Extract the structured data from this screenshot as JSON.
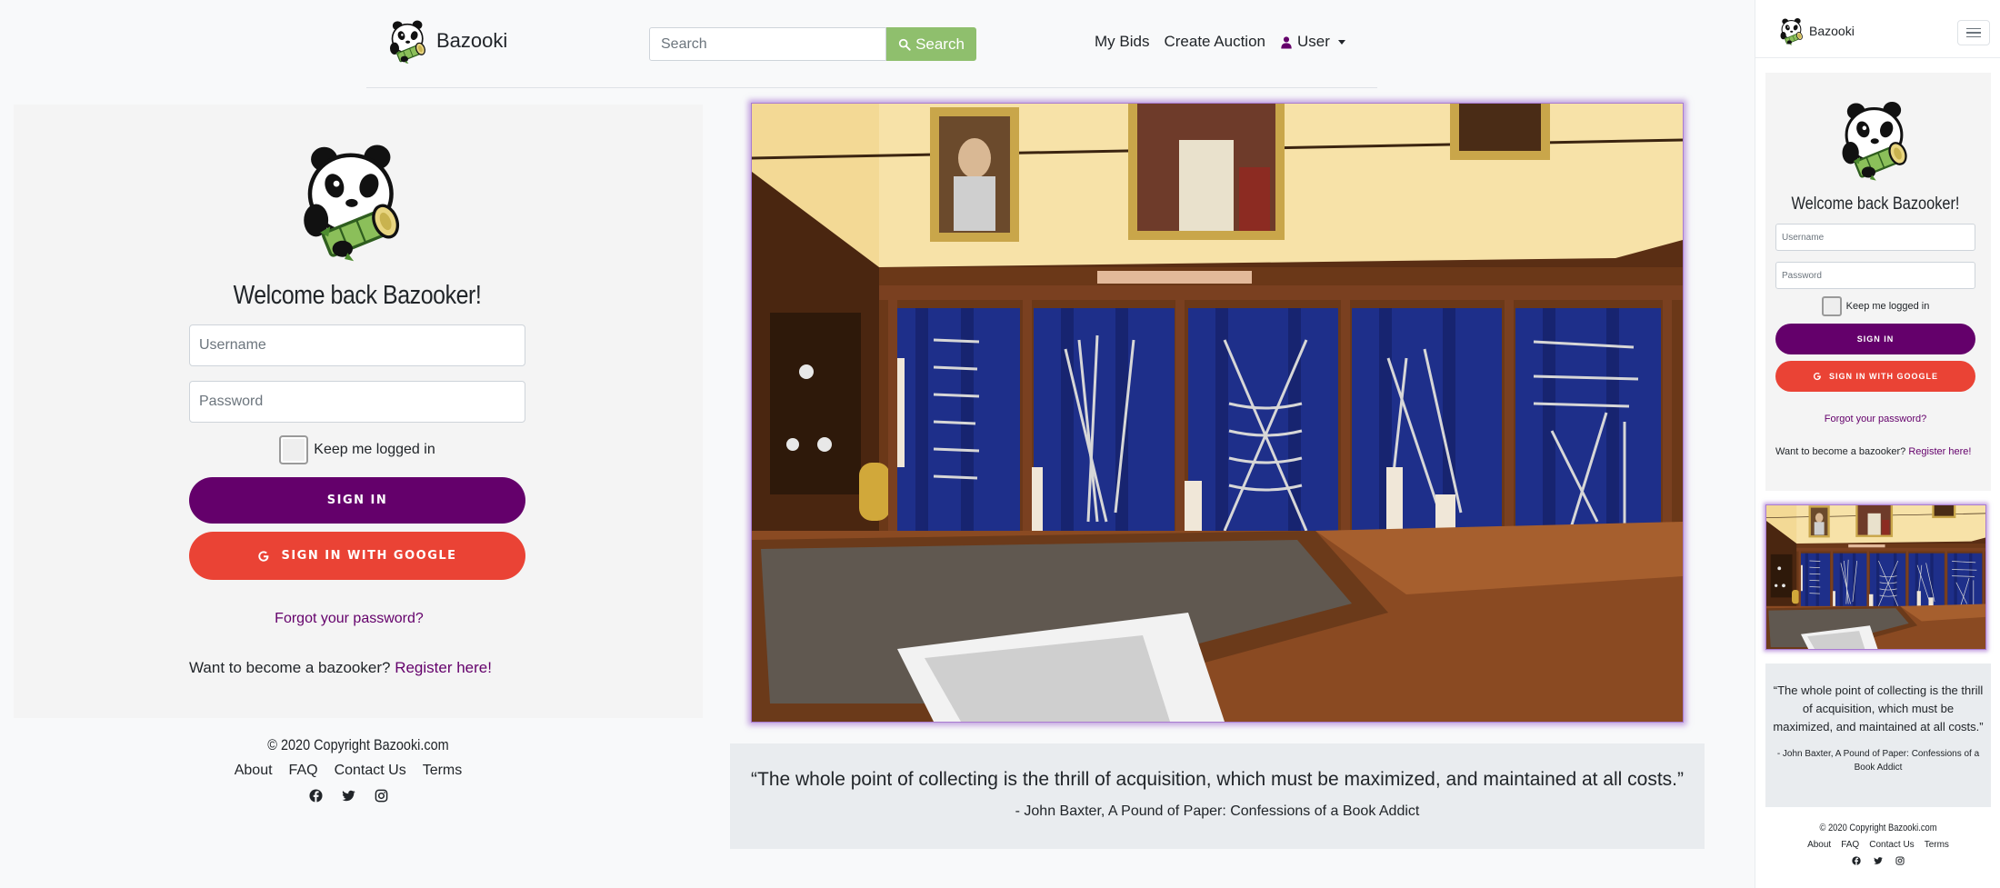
{
  "header": {
    "brand_name": "Bazooki",
    "search_placeholder": "Search",
    "search_button_label": "Search",
    "nav": {
      "my_bids": "My Bids",
      "create_auction": "Create Auction",
      "user": "User"
    }
  },
  "login": {
    "welcome": "Welcome back Bazooker!",
    "username_placeholder": "Username",
    "password_placeholder": "Password",
    "remember_label": "Keep me logged in",
    "signin_label": "SIGN IN",
    "google_label": "SIGN IN WITH GOOGLE",
    "forgot_label": "Forgot your password?",
    "register_prompt": "Want to become a bazooker?",
    "register_link": "Register here!"
  },
  "quote": {
    "text": "“The whole point of collecting is the thrill of acquisition, which must be maximized, and maintained at all costs.”",
    "author": "- John Baxter, A Pound of Paper: Confessions of a Book Addict"
  },
  "footer": {
    "copyright": "© 2020 Copyright Bazooki.com",
    "links": [
      "About",
      "FAQ",
      "Contact Us",
      "Terms"
    ],
    "social_icons": [
      "facebook-icon",
      "twitter-icon",
      "instagram-icon"
    ]
  },
  "colors": {
    "primary_purple": "#64006b",
    "google_red": "#ea4335",
    "search_green": "#8fbf6d",
    "hero_glow": "#a97bd0"
  }
}
